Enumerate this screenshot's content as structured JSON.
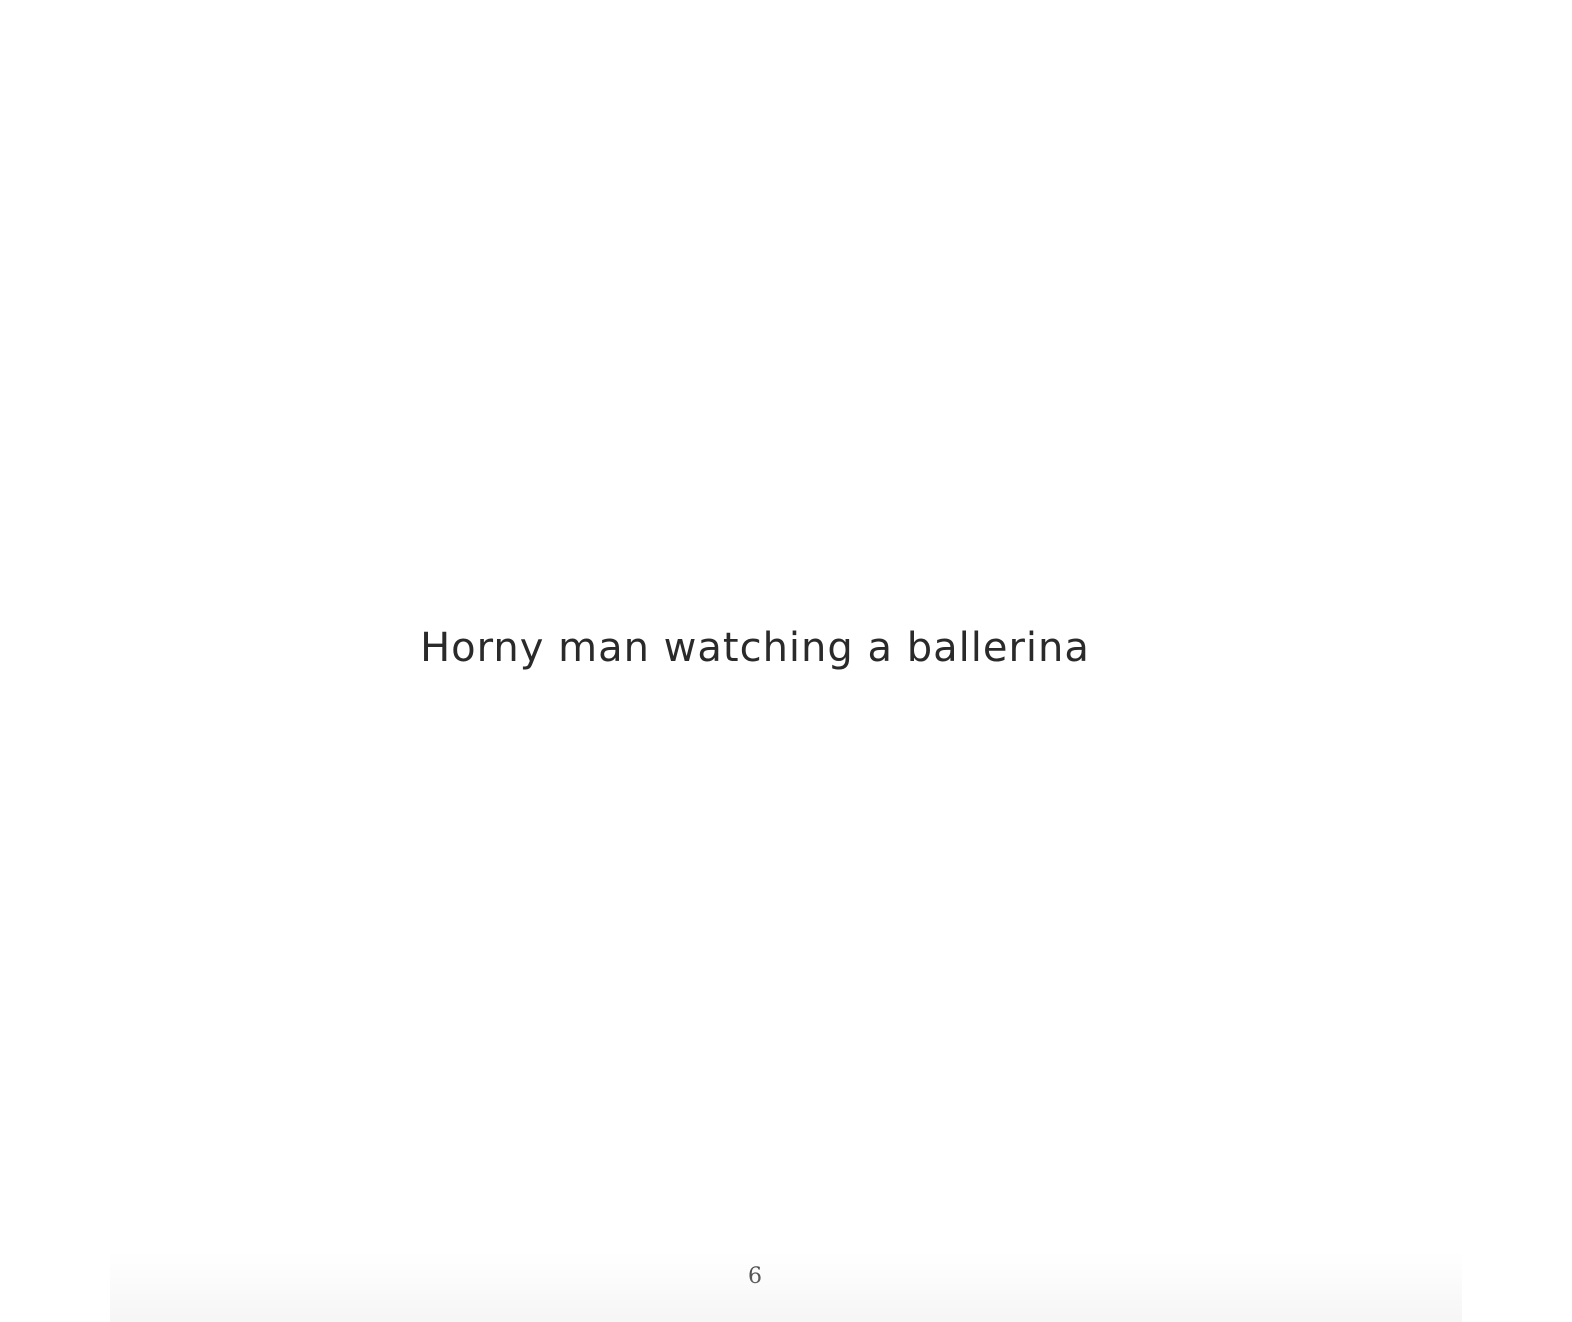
{
  "document": {
    "title": "Horny man watching a ballerina",
    "page_number": "6"
  }
}
